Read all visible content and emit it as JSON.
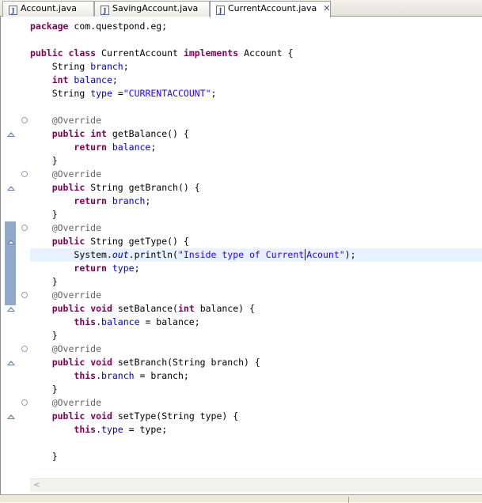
{
  "tabs": [
    {
      "label": "Account.java",
      "icon": "java-file-icon",
      "active": false
    },
    {
      "label": "SavingAccount.java",
      "icon": "java-file-icon",
      "active": false
    },
    {
      "label": "CurrentAccount.java",
      "icon": "java-file-icon",
      "active": true,
      "close_icon": "close-icon"
    }
  ],
  "tab_close_glyph": "✕",
  "java_icon_glyph": "J",
  "code": {
    "package_kw": "package",
    "package_name": " com.questpond.eg;",
    "public": "public",
    "class": "class",
    "implements": "implements",
    "class_name": " CurrentAccount ",
    "interface": " Account {",
    "string_type": "String",
    "int_type": "int",
    "void_type": "void",
    "return": "return",
    "this": "this",
    "field_branch": "branch",
    "field_balance": "balance",
    "field_type": "type",
    "type_init_value": "\"CURRENTACCOUNT\"",
    "override": "@Override",
    "get_balance": " getBalance() {",
    "get_branch": " getBranch() {",
    "get_type": " getType() {",
    "set_balance_name": " setBalance(",
    "set_balance_param": " balance) {",
    "set_branch": " setBranch(String branch) {",
    "set_type": " setType(String type) {",
    "system": "System.",
    "out": "out",
    "println": ".println(",
    "println_arg_a": "\"Inside type of Current",
    "println_arg_b": "Acount\"",
    "println_end": ");",
    "close_brace": "}",
    "semicolon": ";",
    "assign_balance": " = balance;",
    "assign_branch": " = branch;",
    "assign_type": " = type;"
  },
  "ui_colors": {
    "keyword": "#7f0055",
    "string": "#2a00ff",
    "field": "#0000c0",
    "annotation": "#646464",
    "current_line": "#e8f2fe",
    "ruler_highlight": "#91a9c8"
  },
  "scroll_left_glyph": "<"
}
